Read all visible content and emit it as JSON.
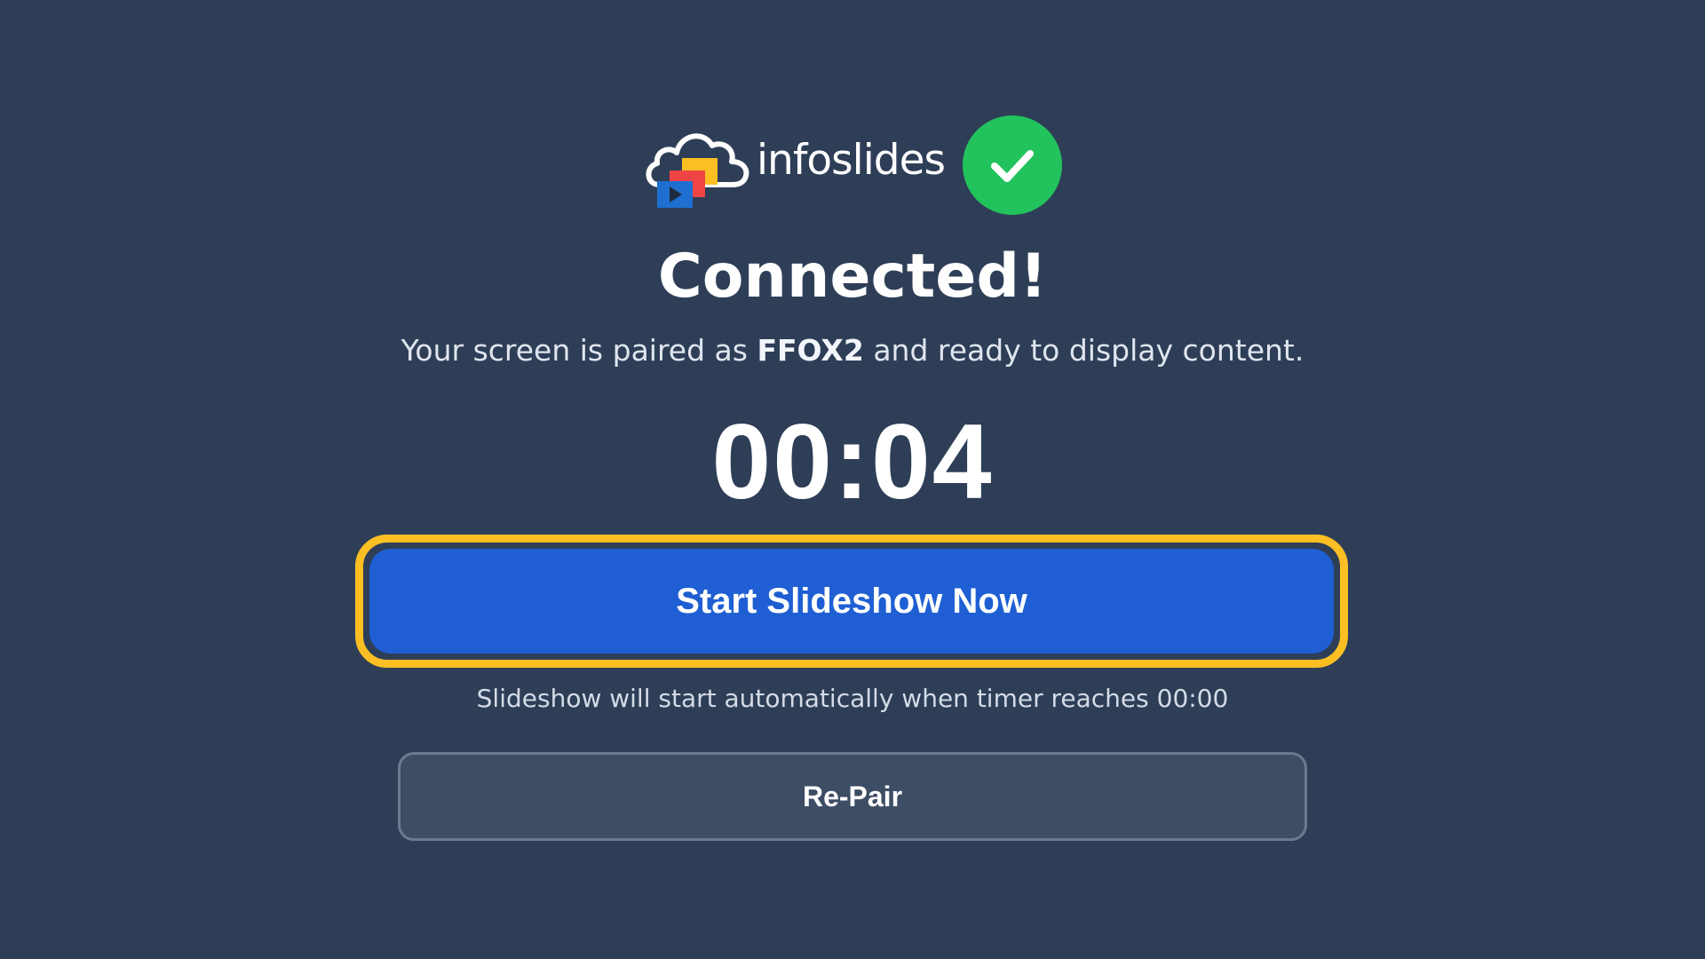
{
  "logo": {
    "text": "infoslides",
    "icon": "cloud-slides-logo-icon"
  },
  "status": {
    "icon": "checkmark-icon",
    "color": "#22c35d"
  },
  "title": "Connected!",
  "subtitle": {
    "prefix": "Your screen is paired as ",
    "screen_name": "FFOX2",
    "suffix": " and ready to display content."
  },
  "timer": "00:04",
  "start_button": {
    "label": "Start Slideshow Now",
    "color": "#1f5fd3",
    "focus_color": "#fbbf24"
  },
  "hint": "Slideshow will start automatically when timer reaches 00:00",
  "repair_button": {
    "label": "Re-Pair"
  },
  "colors": {
    "background": "#2e3e57"
  }
}
